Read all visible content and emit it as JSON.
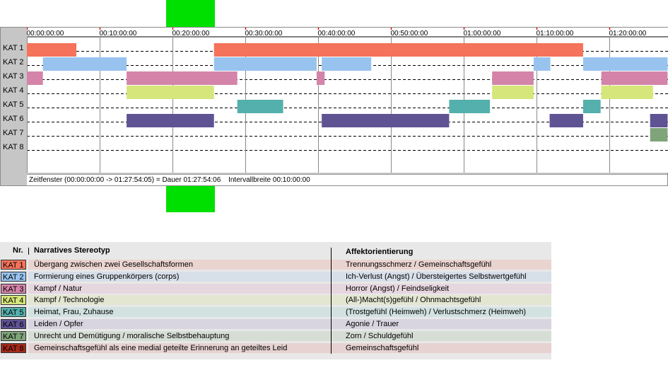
{
  "timeline": {
    "ticks": [
      "00:00:00:00",
      "00:10:00:00",
      "00:20:00:00",
      "00:30:00:00",
      "00:40:00:00",
      "00:50:00:00",
      "01:00:00:00",
      "01:10:00:00",
      "01:20:00:00"
    ],
    "rows": [
      "KAT 1",
      "KAT 2",
      "KAT 3",
      "KAT 4",
      "KAT 5",
      "KAT 6",
      "KAT 7",
      "KAT 8"
    ],
    "status": {
      "window": "Zeitfenster (00:00:00:00 -> 01:27:54:05) = Dauer 01:27:54:06",
      "interval": "Intervallbreite 00:10:00:00"
    },
    "total_minutes": 88,
    "colors": [
      "#f4735a",
      "#98c3ef",
      "#d484a8",
      "#d6e67a",
      "#54b0ac",
      "#5f5394",
      "#80a47a",
      "#a52a1a"
    ],
    "segments": [
      {
        "row": 0,
        "start": 0,
        "end": 6.8
      },
      {
        "row": 0,
        "start": 25.7,
        "end": 76.4
      },
      {
        "row": 1,
        "start": 2.2,
        "end": 13.7
      },
      {
        "row": 1,
        "start": 25.7,
        "end": 39.8
      },
      {
        "row": 1,
        "start": 40.5,
        "end": 47.3
      },
      {
        "row": 1,
        "start": 69.6,
        "end": 71.9
      },
      {
        "row": 1,
        "start": 76.4,
        "end": 88
      },
      {
        "row": 2,
        "start": 0,
        "end": 2.2
      },
      {
        "row": 2,
        "start": 13.7,
        "end": 28.9
      },
      {
        "row": 2,
        "start": 39.8,
        "end": 40.9
      },
      {
        "row": 2,
        "start": 63.9,
        "end": 69.6
      },
      {
        "row": 2,
        "start": 78.9,
        "end": 88
      },
      {
        "row": 3,
        "start": 13.7,
        "end": 25.7
      },
      {
        "row": 3,
        "start": 63.9,
        "end": 69.6
      },
      {
        "row": 3,
        "start": 78.9,
        "end": 86.0
      },
      {
        "row": 4,
        "start": 28.9,
        "end": 35.2
      },
      {
        "row": 4,
        "start": 58.0,
        "end": 63.6
      },
      {
        "row": 4,
        "start": 76.4,
        "end": 78.8
      },
      {
        "row": 5,
        "start": 13.7,
        "end": 25.7
      },
      {
        "row": 5,
        "start": 40.5,
        "end": 58.0
      },
      {
        "row": 5,
        "start": 71.8,
        "end": 76.4
      },
      {
        "row": 5,
        "start": 85.6,
        "end": 88
      },
      {
        "row": 6,
        "start": 85.6,
        "end": 88
      }
    ]
  },
  "legend": {
    "headers": {
      "nr": "Nr.",
      "stereotyp": "Narratives Stereotyp",
      "affekt": "Affektorientierung"
    },
    "items": [
      {
        "kat": "KAT 1",
        "color": "#f4735a",
        "band": "#ead4d0",
        "name": "Übergang zwischen zwei Gesellschaftsformen",
        "affekt": "Trennungsschmerz / Gemeinschaftsgefühl"
      },
      {
        "kat": "KAT 2",
        "color": "#98c3ef",
        "band": "#d7dfe9",
        "name": "Formierung eines Gruppenkörpers (corps)",
        "affekt": "Ich-Verlust (Angst) / Übersteigertes Selbstwertgefühl"
      },
      {
        "kat": "KAT 3",
        "color": "#d484a8",
        "band": "#e6d6de",
        "name": "Kampf / Natur",
        "affekt": "Horror (Angst) / Feindseligkeit"
      },
      {
        "kat": "KAT 4",
        "color": "#d6e67a",
        "band": "#e3e6d0",
        "name": "Kampf / Technologie",
        "affekt": "(All-)Macht(s)gefühl / Ohnmachtsgefühl"
      },
      {
        "kat": "KAT 5",
        "color": "#54b0ac",
        "band": "#d2e2e1",
        "name": "Heimat, Frau, Zuhause",
        "affekt": "(Trostgefühl (Heimweh) / Verlustschmerz (Heimweh)"
      },
      {
        "kat": "KAT 6",
        "color": "#5f5394",
        "band": "#d8d5e0",
        "name": "Leiden / Opfer",
        "affekt": "Agonie / Trauer"
      },
      {
        "kat": "KAT 7",
        "color": "#80a47a",
        "band": "#d6ddd5",
        "name": "Unrecht und Demütigung / moralische Selbstbehauptung",
        "affekt": "Zorn / Schuldgefühl"
      },
      {
        "kat": "KAT 8",
        "color": "#a52a1a",
        "band": "#e6d2d0",
        "name": "Gemeinschaftsgefühl als eine medial geteilte Erinnerung an geteiltes Leid",
        "affekt": "Gemeinschaftsgefühl"
      }
    ]
  }
}
